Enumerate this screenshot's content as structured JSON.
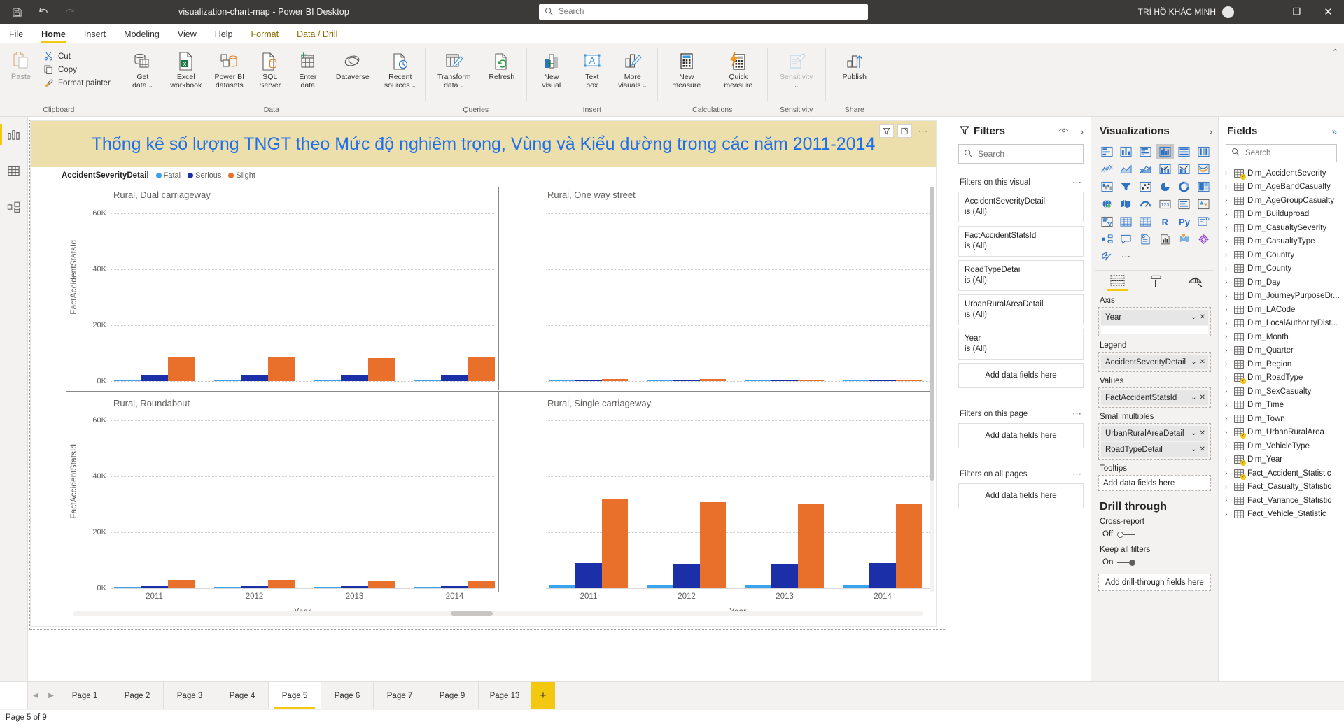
{
  "titlebar": {
    "app_title": "visualization-chart-map - Power BI Desktop",
    "save_icon": "save-icon",
    "undo_icon": "undo-icon",
    "redo_icon": "redo-icon",
    "search_placeholder": "Search",
    "user_name": "TRÍ HỒ KHẮC MINH",
    "minimize": "—",
    "maximize": "❐",
    "close": "✕"
  },
  "menu": {
    "items": [
      {
        "label": "File",
        "state": "normal"
      },
      {
        "label": "Home",
        "state": "active"
      },
      {
        "label": "Insert",
        "state": "normal"
      },
      {
        "label": "Modeling",
        "state": "normal"
      },
      {
        "label": "View",
        "state": "normal"
      },
      {
        "label": "Help",
        "state": "normal"
      },
      {
        "label": "Format",
        "state": "context"
      },
      {
        "label": "Data / Drill",
        "state": "context"
      }
    ]
  },
  "ribbon": {
    "groups": [
      {
        "label": "Clipboard",
        "paste": "Paste",
        "small": [
          {
            "label": "Cut",
            "icon": "scissors-icon"
          },
          {
            "label": "Copy",
            "icon": "copy-icon"
          },
          {
            "label": "Format painter",
            "icon": "paintbrush-icon"
          }
        ]
      },
      {
        "label": "Data",
        "buttons": [
          {
            "label": "Get\ndata",
            "icon": "database-icon",
            "caret": true
          },
          {
            "label": "Excel\nworkbook",
            "icon": "excel-icon",
            "caret": false
          },
          {
            "label": "Power BI\ndatasets",
            "icon": "powerbi-datasets-icon",
            "caret": false
          },
          {
            "label": "SQL\nServer",
            "icon": "sql-server-icon",
            "caret": false
          },
          {
            "label": "Enter\ndata",
            "icon": "enter-data-icon",
            "caret": false
          },
          {
            "label": "Dataverse",
            "icon": "dataverse-icon",
            "caret": false
          },
          {
            "label": "Recent\nsources",
            "icon": "recent-sources-icon",
            "caret": true
          }
        ]
      },
      {
        "label": "Queries",
        "buttons": [
          {
            "label": "Transform\ndata",
            "icon": "transform-data-icon",
            "caret": true
          },
          {
            "label": "Refresh",
            "icon": "refresh-icon",
            "caret": false
          }
        ]
      },
      {
        "label": "Insert",
        "buttons": [
          {
            "label": "New\nvisual",
            "icon": "new-visual-icon",
            "caret": false
          },
          {
            "label": "Text\nbox",
            "icon": "text-box-icon",
            "caret": false
          },
          {
            "label": "More\nvisuals",
            "icon": "more-visuals-icon",
            "caret": true
          }
        ]
      },
      {
        "label": "Calculations",
        "buttons": [
          {
            "label": "New\nmeasure",
            "icon": "new-measure-icon",
            "caret": false
          },
          {
            "label": "Quick\nmeasure",
            "icon": "quick-measure-icon",
            "caret": false
          }
        ]
      },
      {
        "label": "Sensitivity",
        "buttons": [
          {
            "label": "Sensitivity",
            "icon": "sensitivity-icon",
            "caret": true,
            "disabled": true
          }
        ]
      },
      {
        "label": "Share",
        "buttons": [
          {
            "label": "Publish",
            "icon": "publish-icon",
            "caret": false
          }
        ]
      }
    ]
  },
  "left_rail": {
    "items": [
      {
        "name": "report-view",
        "icon": "bar-chart-icon",
        "selected": true
      },
      {
        "name": "data-view",
        "icon": "table-icon",
        "selected": false
      },
      {
        "name": "model-view",
        "icon": "model-icon",
        "selected": false
      }
    ]
  },
  "visual": {
    "title": "Thống kê số lượng TNGT theo Mức độ nghiêm trọng, Vùng và Kiểu dường trong các năm 2011-2014",
    "header_icons": [
      "filter-icon",
      "focus-mode-icon",
      "more-options-icon"
    ],
    "legend_title": "AccidentSeverityDetail",
    "legend": [
      {
        "label": "Fatal",
        "color": "#3BA3EC"
      },
      {
        "label": "Serious",
        "color": "#1A2FA8"
      },
      {
        "label": "Slight",
        "color": "#E8702A"
      }
    ]
  },
  "chart_data": {
    "type": "bar",
    "title": "Thống kê số lượng TNGT theo Mức độ nghiêm trọng, Vùng và Kiểu dường trong các năm 2011-2014",
    "xlabel": "Year",
    "ylabel": "FactAccidentStatsId",
    "categories": [
      "2011",
      "2012",
      "2013",
      "2014"
    ],
    "ylim": [
      0,
      70000
    ],
    "yticks": [
      0,
      20000,
      40000,
      60000
    ],
    "ytick_labels": [
      "0K",
      "20K",
      "40K",
      "60K"
    ],
    "grid": true,
    "legend_position": "top-left",
    "small_multiples_fields": [
      "UrbanRuralAreaDetail",
      "RoadTypeDetail"
    ],
    "series_names": [
      "Fatal",
      "Serious",
      "Slight"
    ],
    "series_colors": [
      "#3BA3EC",
      "#1A2FA8",
      "#E8702A"
    ],
    "panels": [
      {
        "title": "Rural, Dual carriageway",
        "series": [
          {
            "name": "Fatal",
            "values": [
              450,
              430,
              400,
              390
            ]
          },
          {
            "name": "Serious",
            "values": [
              2300,
              2400,
              2300,
              2400
            ]
          },
          {
            "name": "Slight",
            "values": [
              9800,
              9700,
              9600,
              9700
            ]
          }
        ]
      },
      {
        "title": "Rural, One way street",
        "series": [
          {
            "name": "Fatal",
            "values": [
              30,
              28,
              25,
              25
            ]
          },
          {
            "name": "Serious",
            "values": [
              120,
              110,
              105,
              100
            ]
          },
          {
            "name": "Slight",
            "values": [
              430,
              420,
              400,
              400
            ]
          }
        ]
      },
      {
        "title": "Rural, Roundabout",
        "series": [
          {
            "name": "Fatal",
            "values": [
              120,
              110,
              105,
              100
            ]
          },
          {
            "name": "Serious",
            "values": [
              600,
              580,
              560,
              560
            ]
          },
          {
            "name": "Slight",
            "values": [
              3500,
              3400,
              3200,
              3300
            ]
          }
        ]
      },
      {
        "title": "Rural, Single carriageway",
        "series": [
          {
            "name": "Fatal",
            "values": [
              1500,
              1450,
              1400,
              1400
            ]
          },
          {
            "name": "Serious",
            "values": [
              10500,
              10200,
              9900,
              10300
            ]
          },
          {
            "name": "Slight",
            "values": [
              37000,
              35800,
              35000,
              35000
            ]
          }
        ]
      }
    ]
  },
  "filters_pane": {
    "title": "Filters",
    "search_placeholder": "Search",
    "eye_icon": "hide-filters-icon",
    "expand_icon": "chevron-right-icon",
    "sections": [
      {
        "label": "Filters on this visual",
        "cards": [
          {
            "name": "AccidentSeverityDetail",
            "value": "is (All)"
          },
          {
            "name": "FactAccidentStatsId",
            "value": "is (All)"
          },
          {
            "name": "RoadTypeDetail",
            "value": "is (All)"
          },
          {
            "name": "UrbanRuralAreaDetail",
            "value": "is (All)"
          },
          {
            "name": "Year",
            "value": "is (All)"
          }
        ],
        "dropzone": "Add data fields here"
      },
      {
        "label": "Filters on this page",
        "cards": [],
        "dropzone": "Add data fields here"
      },
      {
        "label": "Filters on all pages",
        "cards": [],
        "dropzone": "Add data fields here"
      }
    ]
  },
  "viz_pane": {
    "title": "Visualizations",
    "expand_icon": "chevron-right-icon",
    "gallery": [
      {
        "name": "stacked-bar-chart-icon",
        "selected": false
      },
      {
        "name": "stacked-column-chart-icon",
        "selected": false
      },
      {
        "name": "clustered-bar-chart-icon",
        "selected": false
      },
      {
        "name": "clustered-column-chart-icon",
        "selected": true
      },
      {
        "name": "100-stacked-bar-chart-icon",
        "selected": false
      },
      {
        "name": "100-stacked-column-chart-icon",
        "selected": false
      },
      {
        "name": "line-chart-icon",
        "selected": false
      },
      {
        "name": "area-chart-icon",
        "selected": false
      },
      {
        "name": "stacked-area-chart-icon",
        "selected": false
      },
      {
        "name": "line-stacked-column-chart-icon",
        "selected": false
      },
      {
        "name": "line-clustered-column-chart-icon",
        "selected": false
      },
      {
        "name": "ribbon-chart-icon",
        "selected": false
      },
      {
        "name": "waterfall-chart-icon",
        "selected": false
      },
      {
        "name": "funnel-chart-icon",
        "selected": false
      },
      {
        "name": "scatter-chart-icon",
        "selected": false
      },
      {
        "name": "pie-chart-icon",
        "selected": false
      },
      {
        "name": "donut-chart-icon",
        "selected": false
      },
      {
        "name": "treemap-icon",
        "selected": false
      },
      {
        "name": "map-icon",
        "selected": false
      },
      {
        "name": "filled-map-icon",
        "selected": false
      },
      {
        "name": "gauge-icon",
        "selected": false
      },
      {
        "name": "card-icon",
        "selected": false
      },
      {
        "name": "multi-row-card-icon",
        "selected": false
      },
      {
        "name": "kpi-icon",
        "selected": false
      },
      {
        "name": "slicer-icon",
        "selected": false
      },
      {
        "name": "table-icon",
        "selected": false
      },
      {
        "name": "matrix-icon",
        "selected": false
      },
      {
        "name": "r-script-visual-icon",
        "selected": false
      },
      {
        "name": "python-visual-icon",
        "selected": false
      },
      {
        "name": "key-influencers-icon",
        "selected": false
      },
      {
        "name": "decomposition-tree-icon",
        "selected": false
      },
      {
        "name": "q-and-a-icon",
        "selected": false
      },
      {
        "name": "smart-narrative-icon",
        "selected": false
      },
      {
        "name": "paginated-report-icon",
        "selected": false
      },
      {
        "name": "arcgis-maps-icon",
        "selected": false
      },
      {
        "name": "power-apps-icon",
        "selected": false
      },
      {
        "name": "power-automate-icon",
        "selected": false
      },
      {
        "name": "more-visuals-ellipsis-icon",
        "selected": false
      }
    ],
    "tabs": [
      {
        "name": "fields-tab",
        "icon": "fields-pane-icon",
        "selected": true
      },
      {
        "name": "format-tab",
        "icon": "paint-roller-icon",
        "selected": false
      },
      {
        "name": "analytics-tab",
        "icon": "magnifier-chart-icon",
        "selected": false
      }
    ],
    "wells": [
      {
        "label": "Axis",
        "fields": [
          "Year"
        ],
        "dashed": true
      },
      {
        "label": "Legend",
        "fields": [
          "AccidentSeverityDetail"
        ],
        "dashed": true
      },
      {
        "label": "Values",
        "fields": [
          "FactAccidentStatsId"
        ],
        "dashed": true
      },
      {
        "label": "Small multiples",
        "fields": [
          "UrbanRuralAreaDetail",
          "RoadTypeDetail"
        ],
        "dashed": true
      },
      {
        "label": "Tooltips",
        "fields": [],
        "placeholder": "Add data fields here",
        "dashed": true
      }
    ],
    "drill_through": {
      "title": "Drill through",
      "cross_report_label": "Cross-report",
      "cross_report_state": "Off",
      "keep_all_filters_label": "Keep all filters",
      "keep_all_filters_state": "On",
      "dropzone": "Add drill-through fields here"
    }
  },
  "fields_pane": {
    "title": "Fields",
    "collapse_icon": "double-chevron-right-icon",
    "search_placeholder": "Search",
    "tables": [
      {
        "name": "Dim_AccidentSeverity",
        "checked": true
      },
      {
        "name": "Dim_AgeBandCasualty",
        "checked": false
      },
      {
        "name": "Dim_AgeGroupCasualty",
        "checked": false
      },
      {
        "name": "Dim_Builduproad",
        "checked": false
      },
      {
        "name": "Dim_CasualtySeverity",
        "checked": false
      },
      {
        "name": "Dim_CasualtyType",
        "checked": false
      },
      {
        "name": "Dim_Country",
        "checked": false
      },
      {
        "name": "Dim_County",
        "checked": false
      },
      {
        "name": "Dim_Day",
        "checked": false
      },
      {
        "name": "Dim_JourneyPurposeDr...",
        "checked": false
      },
      {
        "name": "Dim_LACode",
        "checked": false
      },
      {
        "name": "Dim_LocalAuthorityDist...",
        "checked": false
      },
      {
        "name": "Dim_Month",
        "checked": false
      },
      {
        "name": "Dim_Quarter",
        "checked": false
      },
      {
        "name": "Dim_Region",
        "checked": false
      },
      {
        "name": "Dim_RoadType",
        "checked": true
      },
      {
        "name": "Dim_SexCasualty",
        "checked": false
      },
      {
        "name": "Dim_Time",
        "checked": false
      },
      {
        "name": "Dim_Town",
        "checked": false
      },
      {
        "name": "Dim_UrbanRuralArea",
        "checked": true
      },
      {
        "name": "Dim_VehicleType",
        "checked": false
      },
      {
        "name": "Dim_Year",
        "checked": true
      },
      {
        "name": "Fact_Accident_Statistic",
        "checked": true
      },
      {
        "name": "Fact_Casualty_Statistic",
        "checked": false
      },
      {
        "name": "Fact_Variance_Statistic",
        "checked": false
      },
      {
        "name": "Fact_Vehicle_Statistic",
        "checked": false
      }
    ]
  },
  "page_bar": {
    "prev_icon": "chevron-left-icon",
    "next_icon": "chevron-right-icon",
    "tabs": [
      {
        "label": "Page 1",
        "selected": false
      },
      {
        "label": "Page 2",
        "selected": false
      },
      {
        "label": "Page 3",
        "selected": false
      },
      {
        "label": "Page 4",
        "selected": false
      },
      {
        "label": "Page 5",
        "selected": true
      },
      {
        "label": "Page 6",
        "selected": false
      },
      {
        "label": "Page 7",
        "selected": false
      },
      {
        "label": "Page 9",
        "selected": false
      },
      {
        "label": "Page 13",
        "selected": false
      }
    ],
    "add_label": "+"
  },
  "status_bar": {
    "text": "Page 5 of 9"
  }
}
